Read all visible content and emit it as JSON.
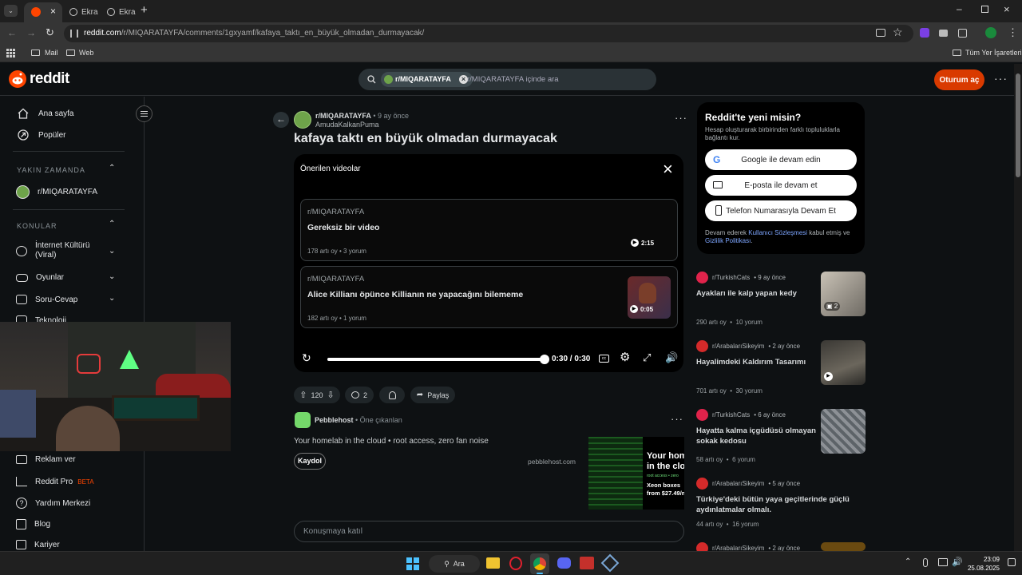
{
  "browser": {
    "tabs": [
      {
        "label": "",
        "active": true
      },
      {
        "label": "Ekra",
        "active": false
      },
      {
        "label": "Ekra",
        "active": false
      }
    ],
    "url_host": "reddit.com",
    "url_path": "/r/MIQARATAYFA/comments/1gxyamf/kafaya_taktı_en_büyük_olmadan_durmayacak/",
    "bookmarks": [
      "Mail",
      "Web"
    ],
    "all_bookmarks": "Tüm Yer İşaretleri"
  },
  "header": {
    "logo": "reddit",
    "search_chip": "r/MIQARATAYFA",
    "search_placeholder": "r/MIQARATAYFA içinde ara",
    "login_button": "Oturum aç"
  },
  "sidebar": {
    "top_items": [
      {
        "label": "Ana sayfa",
        "icon": "home-icon"
      },
      {
        "label": "Popüler",
        "icon": "popular-icon"
      }
    ],
    "recent_header": "YAKIN ZAMANDA",
    "recent_items": [
      {
        "label": "r/MIQARATAYFA"
      }
    ],
    "topics_header": "KONULAR",
    "topics": [
      {
        "label": "İnternet Kültürü (Viral)"
      },
      {
        "label": "Oyunlar"
      },
      {
        "label": "Soru-Cevap"
      },
      {
        "label": "Teknoloji"
      }
    ],
    "bottom_items": [
      {
        "label": "Reklam ver"
      },
      {
        "label": "Reddit Pro",
        "badge": "BETA"
      },
      {
        "label": "Yardım Merkezi"
      },
      {
        "label": "Blog"
      },
      {
        "label": "Kariyer"
      }
    ]
  },
  "post": {
    "subreddit": "r/MIQARATAYFA",
    "time": "• 9 ay önce",
    "author": "AmudaKalkanPuma",
    "title": "kafaya taktı en büyük olmadan durmayacak",
    "player": {
      "heading": "Önerilen videolar",
      "recommendations": [
        {
          "sub": "r/MIQARATAYFA",
          "title": "Gereksiz bir video",
          "stats": "178 artı oy • 3 yorum",
          "duration": "2:15"
        },
        {
          "sub": "r/MIQARATAYFA",
          "title": "Alice Killianı öpünce Killianın ne yapacağını bilememe",
          "stats": "182 artı oy • 1 yorum",
          "duration": "0:05"
        }
      ],
      "time": "0:30 / 0:30",
      "progress": 1.0
    },
    "votes": "120",
    "comments": "2",
    "share": "Paylaş"
  },
  "ad": {
    "name": "Pebblehost",
    "tag": "• Öne çıkanlan",
    "text": "Your homelab in the cloud • root access, zero fan noise",
    "button": "Kaydol",
    "domain": "pebblehost.com",
    "banner_line1": "Your hom",
    "banner_line2": "in the clo",
    "banner_small": "root access • zero",
    "banner_line3": "Xeon boxes",
    "banner_line4": "from $27.49/m"
  },
  "comment_box": {
    "placeholder": "Konuşmaya katıl"
  },
  "login_box": {
    "title": "Reddit'te yeni misin?",
    "subtitle": "Hesap oluşturarak birbirinden farklı topluluklarla bağlantı kur.",
    "google": "Google ile devam edin",
    "email": "E-posta ile devam et",
    "phone": "Telefon Numarasıyla Devam Et",
    "terms_prefix": "Devam ederek ",
    "terms_link": "Kullanıcı Sözleşmesi",
    "terms_mid": " kabul etmiş ve ",
    "privacy_link": "Gizlilik Politikası",
    "terms_suffix": "."
  },
  "related": [
    {
      "sub": "r/TurkishCats",
      "time": "• 9 ay önce",
      "title": "Ayakları ile kalp yapan kedy",
      "upvotes": "290 artı oy",
      "comments": "10 yorum",
      "color": "#e0234b",
      "gallery": "2"
    },
    {
      "sub": "r/ArabalarıSikeyim",
      "time": "• 2 ay önce",
      "title": "Hayalimdeki Kaldırım Tasarımı",
      "upvotes": "701 artı oy",
      "comments": "30 yorum",
      "color": "#d42a2a"
    },
    {
      "sub": "r/TurkishCats",
      "time": "• 6 ay önce",
      "title": "Hayatta kalma içgüdüsü olmayan sokak kedosu",
      "upvotes": "58 artı oy",
      "comments": "6 yorum",
      "color": "#e0234b"
    },
    {
      "sub": "r/ArabalarıSikeyim",
      "time": "• 5 ay önce",
      "title": "Türkiye'deki bütün yaya geçitlerinde güçlü aydınlatmalar olmalı.",
      "upvotes": "44 artı oy",
      "comments": "16 yorum",
      "color": "#d42a2a"
    },
    {
      "sub": "r/ArabalarıSikeyim",
      "time": "• 2 ay önce"
    }
  ],
  "taskbar": {
    "search": "Ara",
    "time": "23:09",
    "date": "25.08.2025"
  }
}
